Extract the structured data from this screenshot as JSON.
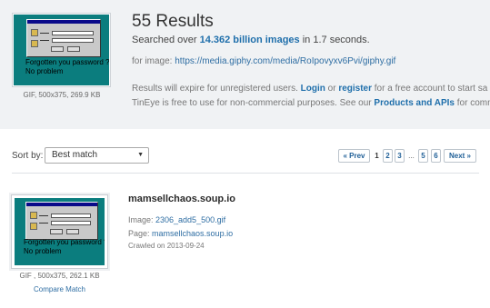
{
  "query": {
    "thumb_meta": "GIF, 500x375, 269.9 KB",
    "gif_text_line1": "Forgotten you password ?",
    "gif_text_line2": "No problem"
  },
  "summary": {
    "results_count": "55 Results",
    "searched_prefix": "Searched over ",
    "searched_count": "14.362 billion images",
    "searched_suffix": " in 1.7 seconds.",
    "for_image_label": "for image: ",
    "for_image_url": "https://media.giphy.com/media/RoIpovyxv6Pvi/giphy.gif",
    "expire_text": "Results will expire for unregistered users. ",
    "login_link": "Login",
    "or_text": " or ",
    "register_link": "register",
    "expire_tail": " for a free account to start sa",
    "free_text": "TinEye is free to use for non-commercial purposes. See our ",
    "products_link": "Products and APIs",
    "free_tail": " for comm"
  },
  "sort": {
    "label": "Sort by:",
    "selected": "Best match",
    "caret_icon": "▼"
  },
  "pager": {
    "prev": "« Prev",
    "pages": [
      "1",
      "2",
      "3",
      "...",
      "5",
      "6"
    ],
    "next": "Next »",
    "current": "1"
  },
  "result": {
    "domain": "mamsellchaos.soup.io",
    "image_label": "Image: ",
    "image_file": "2306_add5_500.gif",
    "page_label": "Page: ",
    "page_link": "mamsellchaos.soup.io",
    "crawled": "Crawled on 2013-09-24",
    "meta": "GIF , 500x375, 262.1 KB",
    "compare": "Compare Match",
    "gif_text_line1": "Forgotten you password ?",
    "gif_text_line2": "No problem"
  },
  "colors": {
    "accent_link": "#1f6fab",
    "header_bg": "#f0f2f4",
    "gif_teal": "#0b7d7e"
  }
}
